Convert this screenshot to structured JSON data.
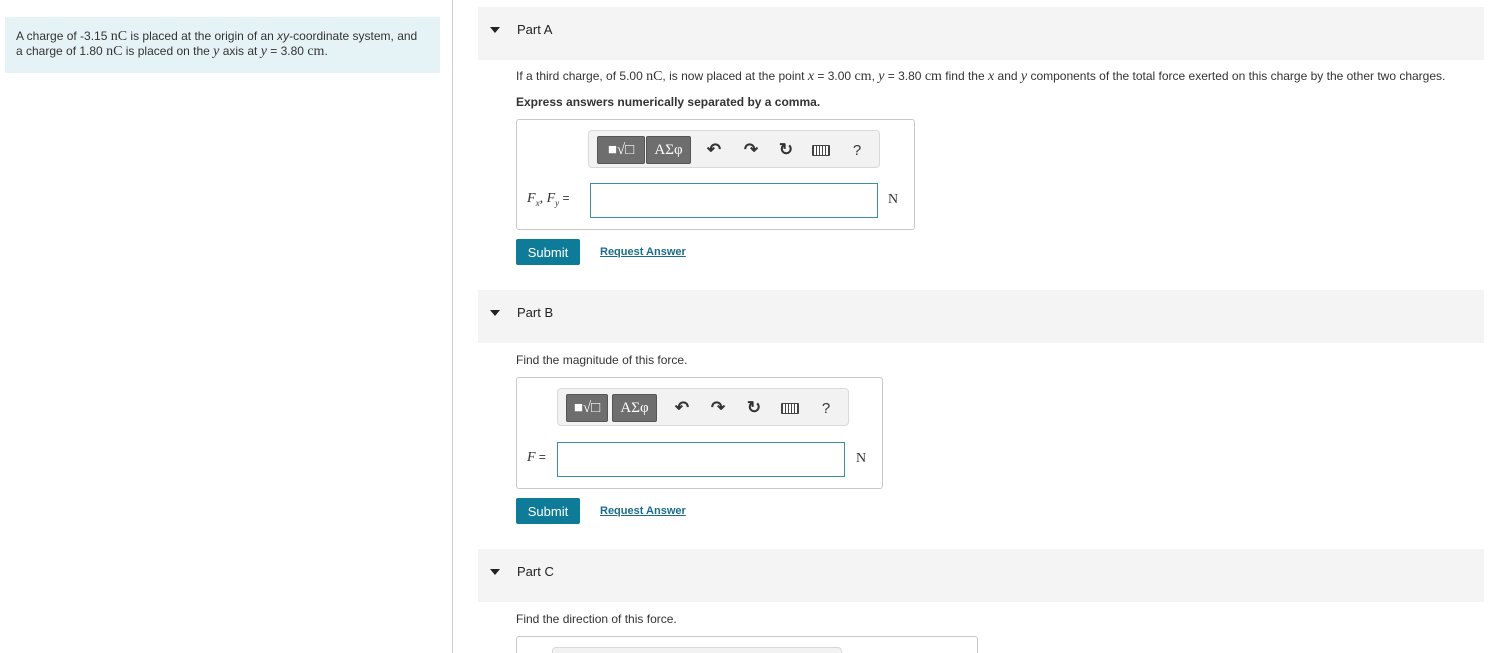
{
  "problem": {
    "text_1": "A charge of -3.15 ",
    "unit_nc_1": "nC",
    "text_2": " is placed at the origin of an ",
    "xy": "xy",
    "text_3": "-coordinate system, and",
    "text_4": "a charge of 1.80 ",
    "unit_nc_2": "nC",
    "text_5": " is placed on the ",
    "y_var": "y",
    "text_6": " axis at ",
    "y_var_2": "y",
    "text_7": " = 3.80 ",
    "unit_cm": "cm",
    "text_8": "."
  },
  "parts": [
    {
      "title": "Part A",
      "prompt": {
        "p1": "If a third charge, of 5.00 ",
        "nc": "nC",
        "p2": ", is now placed at the point ",
        "x": "x",
        "p3": " = 3.00 ",
        "cm1": "cm",
        "p4": ", ",
        "y": "y",
        "p5": " = 3.80 ",
        "cm2": "cm",
        "p6": " find the ",
        "x2": "x",
        "p7": " and ",
        "y2": "y",
        "p8": " components of the total force exerted on this charge by the other two charges."
      },
      "instruction": "Express answers numerically separated by a comma.",
      "label": {
        "f1": "F",
        "sub1": "x",
        "sep": ", ",
        "f2": "F",
        "sub2": "y",
        "eq": " ="
      },
      "value": "",
      "unit": "N",
      "submit_label": "Submit",
      "request_label": "Request Answer"
    },
    {
      "title": "Part B",
      "prompt": "Find the magnitude of this force.",
      "label": {
        "f": "F",
        "eq": " ="
      },
      "value": "",
      "unit": "N",
      "submit_label": "Submit",
      "request_label": "Request Answer"
    },
    {
      "title": "Part C",
      "prompt": "Find the direction of this force."
    }
  ],
  "toolbar": {
    "template_label": "■√□",
    "greek_label": "ΑΣφ",
    "undo_icon": "↶",
    "redo_icon": "↷",
    "reset_icon": "↻",
    "keyboard_icon": "keyboard-icon",
    "help_label": "?"
  }
}
